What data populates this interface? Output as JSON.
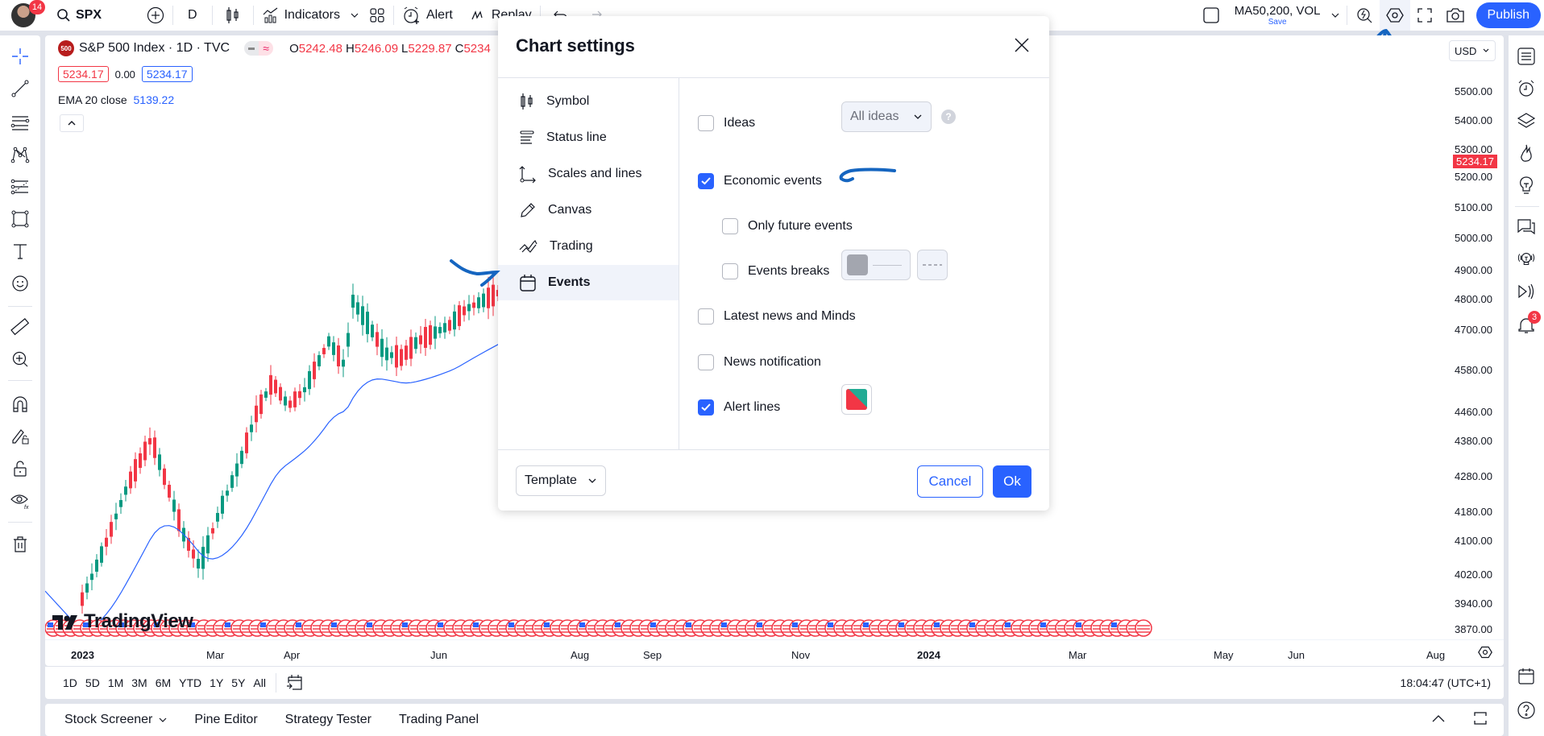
{
  "topbar": {
    "avatar_badge": "14",
    "symbol": "SPX",
    "interval": "D",
    "indicators_label": "Indicators",
    "alert_label": "Alert",
    "replay_label": "Replay",
    "layout_name": "MA50,200, VOL",
    "layout_save": "Save",
    "publish_label": "Publish"
  },
  "legend": {
    "logo_text": "500",
    "title": "S&P 500 Index · 1D · TVC",
    "ohlc": [
      {
        "k": "O",
        "v": "5242.48"
      },
      {
        "k": "H",
        "v": "5246.09"
      },
      {
        "k": "L",
        "v": "5229.87"
      },
      {
        "k": "C",
        "v": "5234"
      }
    ],
    "sell_price": "5234.17",
    "spread": "0.00",
    "buy_price": "5234.17",
    "ema_label": "EMA 20 close",
    "ema_value": "5139.22"
  },
  "price_axis": {
    "currency": "USD",
    "ticks": [
      "5500.00",
      "5400.00",
      "5300.00",
      "5200.00",
      "5100.00",
      "5000.00",
      "4900.00",
      "4800.00",
      "4700.00",
      "4580.00",
      "4460.00",
      "4380.00",
      "4280.00",
      "4180.00",
      "4100.00",
      "4020.00",
      "3940.00",
      "3870.00"
    ],
    "last_price": "5234.17"
  },
  "time_axis": {
    "labels": [
      {
        "text": "2023",
        "bold": true
      },
      {
        "text": "Mar"
      },
      {
        "text": "Apr"
      },
      {
        "text": "Jun"
      },
      {
        "text": "Aug"
      },
      {
        "text": "Sep"
      },
      {
        "text": "Nov"
      },
      {
        "text": "2024",
        "bold": true
      },
      {
        "text": "Mar"
      },
      {
        "text": "May"
      },
      {
        "text": "Jun"
      },
      {
        "text": "Aug"
      }
    ]
  },
  "watermark": "TradingView",
  "range_bar": {
    "ranges": [
      "1D",
      "5D",
      "1M",
      "3M",
      "6M",
      "YTD",
      "1Y",
      "5Y",
      "All"
    ],
    "clock": "18:04:47 (UTC+1)"
  },
  "bottom_panel": {
    "tabs": [
      "Stock Screener",
      "Pine Editor",
      "Strategy Tester",
      "Trading Panel"
    ]
  },
  "right_bar": {
    "alerts_badge": "3"
  },
  "dialog": {
    "title": "Chart settings",
    "nav": [
      {
        "label": "Symbol",
        "icon": "candles-icon"
      },
      {
        "label": "Status line",
        "icon": "status-line-icon"
      },
      {
        "label": "Scales and lines",
        "icon": "scales-icon"
      },
      {
        "label": "Canvas",
        "icon": "pencil-icon"
      },
      {
        "label": "Trading",
        "icon": "trading-icon"
      },
      {
        "label": "Events",
        "icon": "calendar-icon",
        "active": true
      }
    ],
    "options": {
      "ideas": {
        "label": "Ideas",
        "checked": false,
        "select_value": "All ideas"
      },
      "economic_events": {
        "label": "Economic events",
        "checked": true
      },
      "only_future": {
        "label": "Only future events",
        "checked": false
      },
      "events_breaks": {
        "label": "Events breaks",
        "checked": false,
        "color": "#a3a6af"
      },
      "latest_news": {
        "label": "Latest news and Minds",
        "checked": false
      },
      "news_notification": {
        "label": "News notification",
        "checked": false
      },
      "alert_lines": {
        "label": "Alert lines",
        "checked": true,
        "colors": [
          "#f23645",
          "#22ab94"
        ]
      }
    },
    "template_label": "Template",
    "cancel_label": "Cancel",
    "ok_label": "Ok"
  },
  "colors": {
    "accent": "#2962ff",
    "up": "#089981",
    "down": "#f23645",
    "ema": "#2962ff",
    "annotation": "#1565c0"
  }
}
